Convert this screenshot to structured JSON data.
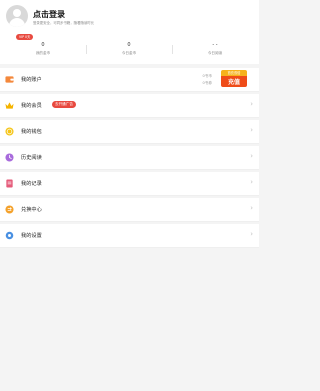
{
  "header": {
    "login_title": "点击登录",
    "login_subtitle": "登录更安全，可同步书籍，随看随读时长"
  },
  "stats": [
    {
      "value": "0",
      "label": "我的金币"
    },
    {
      "value": "0",
      "label": "今日金币"
    },
    {
      "value": "- -",
      "label": "今日阅读"
    }
  ],
  "vip_tag": "VIP 0天",
  "menu": [
    {
      "label": "我的账户",
      "icon": "wallet-icon",
      "color": "#f4883b"
    },
    {
      "label": "我的会员",
      "icon": "crown-icon",
      "color": "#f5b400",
      "promo": "去开通广告"
    },
    {
      "label": "我的钱包",
      "icon": "coin-icon",
      "color": "#f5c518"
    },
    {
      "label": "历史阅读",
      "icon": "clock-icon",
      "color": "#a86bdc"
    },
    {
      "label": "我的记录",
      "icon": "document-icon",
      "color": "#e55b7a"
    },
    {
      "label": "兑换中心",
      "icon": "exchange-icon",
      "color": "#f4a12a"
    },
    {
      "label": "我的设置",
      "icon": "gear-icon",
      "color": "#4a90e2"
    }
  ],
  "account": {
    "balance_line1": "0书币",
    "balance_line2": "0书券",
    "recharge_top": "首充双倍",
    "recharge_label": "充值"
  },
  "colors": {
    "accent": "#ef4c19",
    "promo": "#e8493f",
    "recharge_top": "#f6b21c"
  }
}
